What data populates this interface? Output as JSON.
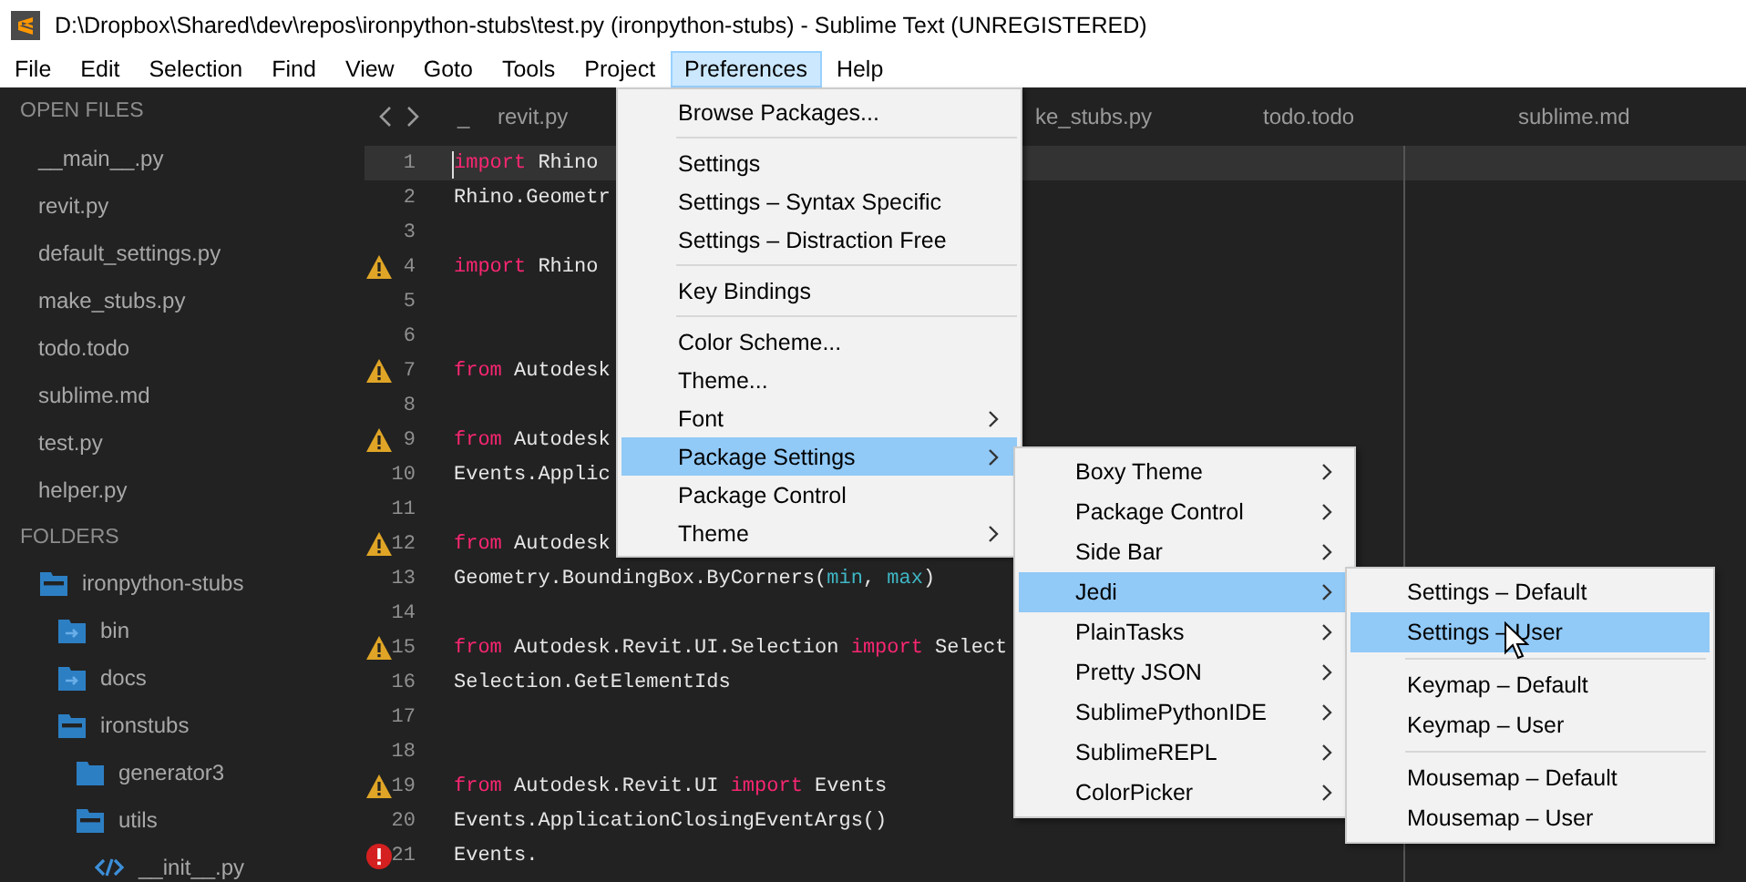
{
  "window": {
    "title": "D:\\Dropbox\\Shared\\dev\\repos\\ironpython-stubs\\test.py (ironpython-stubs) - Sublime Text (UNREGISTERED)"
  },
  "menu_bar": [
    {
      "label": "File",
      "selected": false
    },
    {
      "label": "Edit",
      "selected": false
    },
    {
      "label": "Selection",
      "selected": false
    },
    {
      "label": "Find",
      "selected": false
    },
    {
      "label": "View",
      "selected": false
    },
    {
      "label": "Goto",
      "selected": false
    },
    {
      "label": "Tools",
      "selected": false
    },
    {
      "label": "Project",
      "selected": false
    },
    {
      "label": "Preferences",
      "selected": true
    },
    {
      "label": "Help",
      "selected": false
    }
  ],
  "sidebar": {
    "open_files_title": "OPEN FILES",
    "open_files": [
      "__main__.py",
      "revit.py",
      "default_settings.py",
      "make_stubs.py",
      "todo.todo",
      "sublime.md",
      "test.py",
      "helper.py"
    ],
    "folders_title": "FOLDERS",
    "folders": [
      {
        "label": "ironpython-stubs",
        "kind": "folder",
        "expanded": true,
        "children": [
          {
            "label": "bin",
            "kind": "linked-folder"
          },
          {
            "label": "docs",
            "kind": "linked-folder"
          },
          {
            "label": "ironstubs",
            "kind": "folder",
            "expanded": true,
            "children": [
              {
                "label": "generator3",
                "kind": "folder",
                "expanded": false
              },
              {
                "label": "utils",
                "kind": "folder",
                "expanded": true,
                "children": [
                  {
                    "label": "__init__.py",
                    "kind": "file"
                  }
                ]
              }
            ]
          }
        ]
      }
    ]
  },
  "tabs": [
    "_",
    "revit.py",
    "ke_stubs.py",
    "todo.todo",
    "sublime.md"
  ],
  "code_lines": [
    {
      "number": "1",
      "current": true,
      "cursor": true,
      "tokens": [
        {
          "text": "import",
          "kind": "keyword"
        },
        {
          "text": " Rhino",
          "kind": "plain"
        }
      ]
    },
    {
      "number": "2",
      "tokens": [
        {
          "text": "Rhino.Geometr",
          "kind": "plain"
        }
      ]
    },
    {
      "number": "3"
    },
    {
      "number": "4",
      "kind": "warning",
      "tokens": [
        {
          "text": "import",
          "kind": "keyword"
        },
        {
          "text": " Rhino",
          "kind": "plain"
        }
      ]
    },
    {
      "number": "5"
    },
    {
      "number": "6"
    },
    {
      "number": "7",
      "kind": "warning",
      "tokens": [
        {
          "text": "from",
          "kind": "keyword"
        },
        {
          "text": " Autodesk",
          "kind": "plain"
        }
      ]
    },
    {
      "number": "8"
    },
    {
      "number": "9",
      "kind": "warning",
      "tokens": [
        {
          "text": "from",
          "kind": "keyword"
        },
        {
          "text": " Autodesk",
          "kind": "plain"
        }
      ]
    },
    {
      "number": "10",
      "tokens": [
        {
          "text": "Events.Applic",
          "kind": "plain"
        }
      ]
    },
    {
      "number": "11"
    },
    {
      "number": "12",
      "kind": "warning",
      "tokens": [
        {
          "text": "from",
          "kind": "keyword"
        },
        {
          "text": " Autodesk",
          "kind": "plain"
        }
      ]
    },
    {
      "number": "13",
      "tokens": [
        {
          "text": "Geometry.BoundingBox.ByCorners(",
          "kind": "plain"
        },
        {
          "text": "min",
          "kind": "param"
        },
        {
          "text": ", ",
          "kind": "plain"
        },
        {
          "text": "max",
          "kind": "param"
        },
        {
          "text": ")",
          "kind": "plain"
        }
      ]
    },
    {
      "number": "14"
    },
    {
      "number": "15",
      "kind": "warning",
      "tokens": [
        {
          "text": "from",
          "kind": "keyword"
        },
        {
          "text": " Autodesk.Revit.UI.Selection ",
          "kind": "plain"
        },
        {
          "text": "import",
          "kind": "keyword"
        },
        {
          "text": " Select",
          "kind": "plain"
        }
      ]
    },
    {
      "number": "16",
      "tokens": [
        {
          "text": "Selection.GetElementIds",
          "kind": "plain"
        }
      ]
    },
    {
      "number": "17"
    },
    {
      "number": "18"
    },
    {
      "number": "19",
      "kind": "warning",
      "tokens": [
        {
          "text": "from",
          "kind": "keyword"
        },
        {
          "text": " Autodesk.Revit.UI ",
          "kind": "plain"
        },
        {
          "text": "import",
          "kind": "keyword"
        },
        {
          "text": " Events",
          "kind": "plain"
        }
      ]
    },
    {
      "number": "20",
      "tokens": [
        {
          "text": "Events.ApplicationClosingEventArgs()",
          "kind": "plain"
        }
      ]
    },
    {
      "number": "21",
      "kind": "error",
      "tokens": [
        {
          "text": "Events.",
          "kind": "plain"
        }
      ]
    }
  ],
  "menus": [
    {
      "items": [
        {
          "kind": "item",
          "label": "Browse Packages...",
          "submenu": false,
          "selected": false
        },
        {
          "kind": "separator"
        },
        {
          "kind": "item",
          "label": "Settings",
          "submenu": false,
          "selected": false
        },
        {
          "kind": "item",
          "label": "Settings – Syntax Specific",
          "submenu": false,
          "selected": false
        },
        {
          "kind": "item",
          "label": "Settings – Distraction Free",
          "submenu": false,
          "selected": false
        },
        {
          "kind": "separator"
        },
        {
          "kind": "item",
          "label": "Key Bindings",
          "submenu": false,
          "selected": false
        },
        {
          "kind": "separator"
        },
        {
          "kind": "item",
          "label": "Color Scheme...",
          "submenu": false,
          "selected": false
        },
        {
          "kind": "item",
          "label": "Theme...",
          "submenu": false,
          "selected": false
        },
        {
          "kind": "item",
          "label": "Font",
          "submenu": true,
          "selected": false
        },
        {
          "kind": "item",
          "label": "Package Settings",
          "submenu": true,
          "selected": true
        },
        {
          "kind": "item",
          "label": "Package Control",
          "submenu": false,
          "selected": false
        },
        {
          "kind": "item",
          "label": "Theme",
          "submenu": true,
          "selected": false
        }
      ]
    },
    {
      "items": [
        {
          "kind": "item",
          "label": "Boxy Theme",
          "submenu": true,
          "selected": false
        },
        {
          "kind": "item",
          "label": "Package Control",
          "submenu": true,
          "selected": false
        },
        {
          "kind": "item",
          "label": "Side Bar",
          "submenu": true,
          "selected": false
        },
        {
          "kind": "item",
          "label": "Jedi",
          "submenu": true,
          "selected": true
        },
        {
          "kind": "item",
          "label": "PlainTasks",
          "submenu": true,
          "selected": false
        },
        {
          "kind": "item",
          "label": "Pretty JSON",
          "submenu": true,
          "selected": false
        },
        {
          "kind": "item",
          "label": "SublimePythonIDE",
          "submenu": true,
          "selected": false
        },
        {
          "kind": "item",
          "label": "SublimeREPL",
          "submenu": true,
          "selected": false
        },
        {
          "kind": "item",
          "label": "ColorPicker",
          "submenu": true,
          "selected": false
        }
      ]
    },
    {
      "items": [
        {
          "kind": "item",
          "label": "Settings – Default",
          "submenu": false,
          "selected": false
        },
        {
          "kind": "item",
          "label": "Settings – User",
          "submenu": false,
          "selected": true
        },
        {
          "kind": "separator"
        },
        {
          "kind": "item",
          "label": "Keymap – Default",
          "submenu": false,
          "selected": false
        },
        {
          "kind": "item",
          "label": "Keymap – User",
          "submenu": false,
          "selected": false
        },
        {
          "kind": "separator"
        },
        {
          "kind": "item",
          "label": "Mousemap – Default",
          "submenu": false,
          "selected": false
        },
        {
          "kind": "item",
          "label": "Mousemap – User",
          "submenu": false,
          "selected": false
        }
      ]
    }
  ]
}
